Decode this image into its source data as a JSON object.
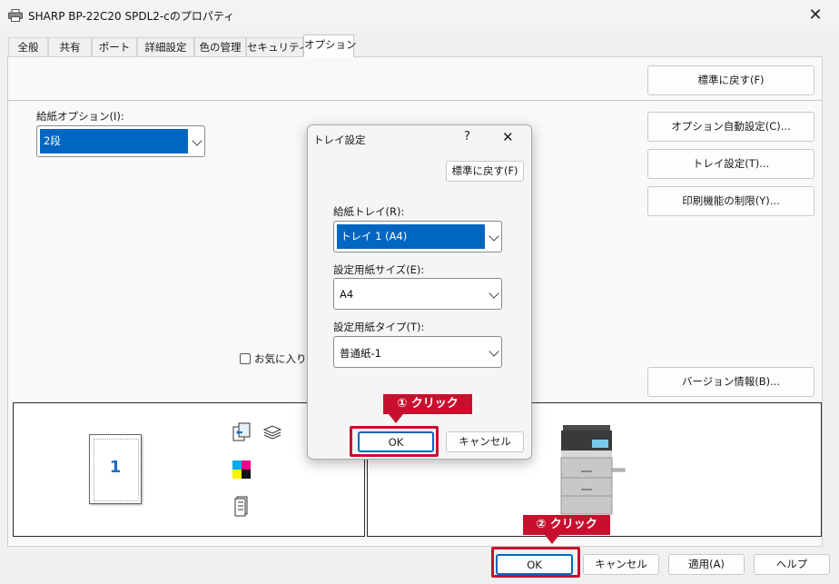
{
  "window": {
    "title": "SHARP BP-22C20 SPDL2-cのプロパティ",
    "close_glyph": "✕",
    "icon": "printer-icon"
  },
  "tabs": [
    {
      "label": "全般"
    },
    {
      "label": "共有"
    },
    {
      "label": "ポート"
    },
    {
      "label": "詳細設定"
    },
    {
      "label": "色の管理"
    },
    {
      "label": "セキュリティ"
    },
    {
      "label": "オプション",
      "active": true
    }
  ],
  "options": {
    "restore_default": "標準に戻す(F)",
    "paper_feed_label": "給紙オプション(I):",
    "paper_feed_value": "2段",
    "auto_config": "オプション自動設定(C)...",
    "tray_settings": "トレイ設定(T)...",
    "restrict_print": "印刷機能の制限(Y)...",
    "favorites_label": "お気に入りE",
    "version_info": "バージョン情報(B)...",
    "page_number": "1"
  },
  "dialog": {
    "title": "トレイ設定",
    "help_glyph": "?",
    "close_glyph": "✕",
    "restore_default": "標準に戻す(F)",
    "feed_tray_label": "給紙トレイ(R):",
    "feed_tray_value": "トレイ 1 (A4)",
    "paper_size_label": "設定用紙サイズ(E):",
    "paper_size_value": "A4",
    "paper_type_label": "設定用紙タイプ(T):",
    "paper_type_value": "普通紙-1",
    "ok": "OK",
    "cancel": "キャンセル"
  },
  "bottom": {
    "ok": "OK",
    "cancel": "キャンセル",
    "apply": "適用(A)",
    "help": "ヘルプ"
  },
  "annotations": {
    "step1": "① クリック",
    "step2": "② クリック"
  },
  "colors": {
    "selection": "#0067c0",
    "annotation_red": "#c8102e"
  }
}
